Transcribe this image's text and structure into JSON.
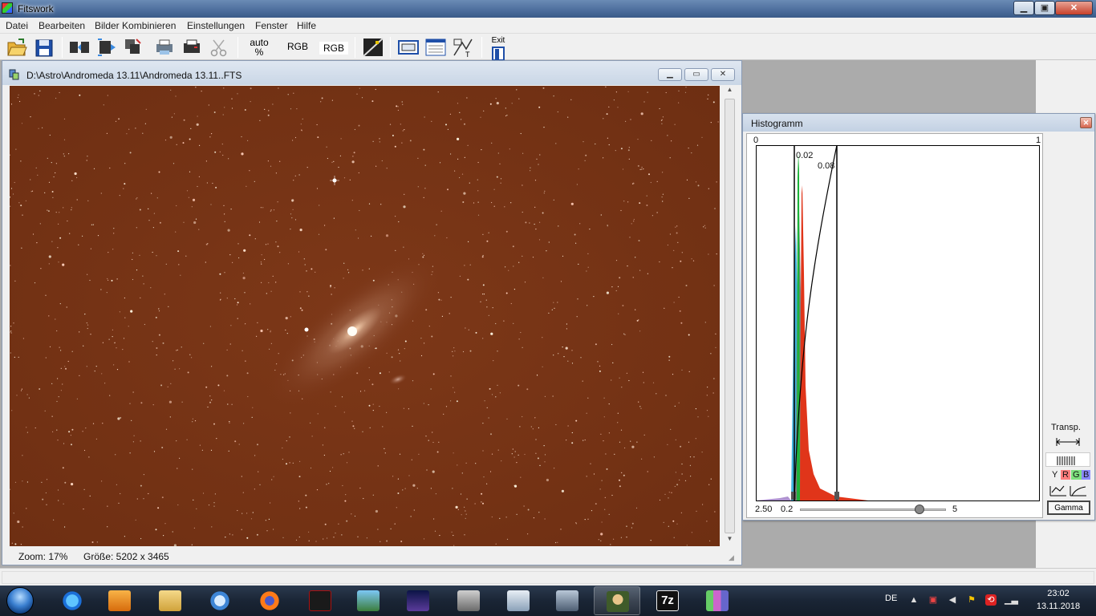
{
  "app": {
    "title": "Fitswork"
  },
  "menu": [
    "Datei",
    "Bearbeiten",
    "Bilder Kombinieren",
    "Einstellungen",
    "Fenster",
    "Hilfe"
  ],
  "toolbar": {
    "auto_label_1": "auto",
    "auto_label_2": "%",
    "rgb_label_1": "RGB",
    "rgb_label_2": "RGB",
    "exit_label": "Exit",
    "icons": [
      "open-folder-icon",
      "save-disk-icon",
      "flip-horizontal-icon",
      "resize-icon",
      "copy-stack-icon",
      "print-icon",
      "printer-icon",
      "scissors-icon",
      "levels-icon",
      "frame-icon",
      "grid-window-icon",
      "measure-icon"
    ]
  },
  "image_window": {
    "title": "D:\\Astro\\Andromeda 13.11\\Andromeda 13.11..FTS",
    "zoom": "Zoom: 17%",
    "size": "Größe: 5202 x 3465"
  },
  "histogram": {
    "title": "Histogramm",
    "scale_min": "0",
    "scale_max": "1",
    "black_point": "0.02",
    "white_point": "0.08",
    "gamma_value": "2.50",
    "slider_min": "0.2",
    "slider_max": "5",
    "gamma_fraction": 0.82,
    "transp_label": "Transp.",
    "channels": [
      "Y",
      "R",
      "G",
      "B"
    ],
    "channel_colors": {
      "Y": "#f0f0f0",
      "R": "#ff7d7d",
      "G": "#7de07d",
      "B": "#8a8aff"
    },
    "gamma_button": "Gamma"
  },
  "tray": {
    "language": "DE",
    "time": "23:02",
    "date": "13.11.2018"
  },
  "colors": {
    "sky": "#7a3416",
    "accent_titlebar": "#4c6d9c"
  }
}
